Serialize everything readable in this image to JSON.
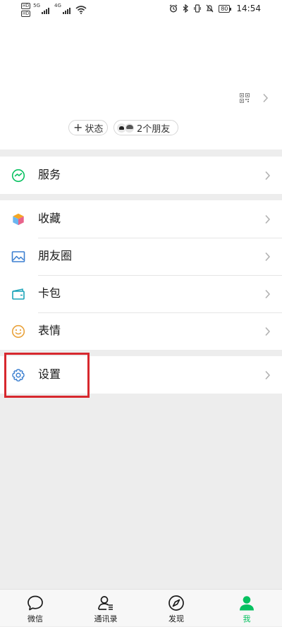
{
  "status_bar": {
    "hd1": "HD",
    "hd2": "HD",
    "net1": "5G",
    "net2": "4G",
    "battery": "80",
    "time": "14:54"
  },
  "profile": {
    "status_chip": "状态",
    "friends_chip": "2个朋友"
  },
  "menu": {
    "services": "服务",
    "favorites": "收藏",
    "moments": "朋友圈",
    "cards": "卡包",
    "stickers": "表情",
    "settings": "设置"
  },
  "tabs": {
    "chats": "微信",
    "contacts": "通讯录",
    "discover": "发现",
    "me": "我"
  },
  "colors": {
    "accent": "#07c160",
    "highlight_box": "#d7282e",
    "background": "#ededed"
  }
}
